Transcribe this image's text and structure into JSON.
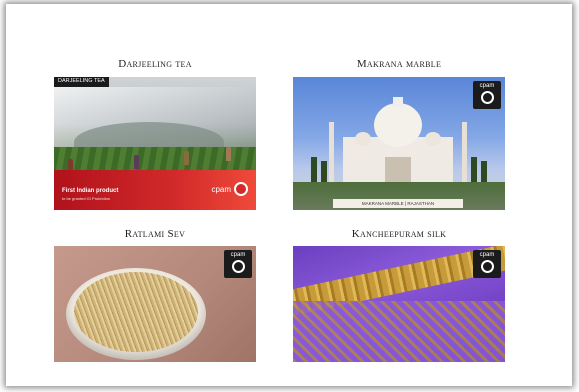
{
  "slide": {
    "items": [
      {
        "caption": "Darjeeling tea"
      },
      {
        "caption": "Makrana marble"
      },
      {
        "caption": "Ratlami Sev"
      },
      {
        "caption": "Kancheepuram silk"
      }
    ]
  },
  "darjeeling": {
    "tag": "DARJEELING TEA",
    "headline": "First Indian product",
    "subline": "to be granted GI Protection"
  },
  "makrana": {
    "label": "MAKRANA MARBLE | RAJASTHAN"
  },
  "logo": {
    "text": "cpam"
  }
}
